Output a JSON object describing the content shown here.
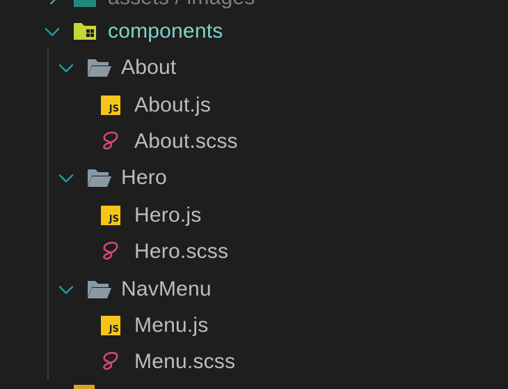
{
  "explorer": {
    "partial_top_label": "assets / images",
    "components_label": "components",
    "items": [
      {
        "label": "About",
        "type": "folder"
      },
      {
        "label": "About.js",
        "type": "js"
      },
      {
        "label": "About.scss",
        "type": "scss"
      },
      {
        "label": "Hero",
        "type": "folder"
      },
      {
        "label": "Hero.js",
        "type": "js"
      },
      {
        "label": "Hero.scss",
        "type": "scss"
      },
      {
        "label": "NavMenu",
        "type": "folder"
      },
      {
        "label": "Menu.js",
        "type": "js"
      },
      {
        "label": "Menu.scss",
        "type": "scss"
      }
    ],
    "js_badge": "JS"
  },
  "colors": {
    "background": "#1e1e1e",
    "text": "#bdbdbd",
    "components_text": "#7fd3c8",
    "chevron": "#1aa3a3",
    "folder_gray": "#8a9aa5",
    "components_folder": "#c4d63a",
    "sass_pink": "#d9457c",
    "js_yellow": "#f5c518"
  },
  "icons": {
    "chevron": "chevron-down-icon",
    "folder": "folder-open-icon",
    "js": "javascript-file-icon",
    "scss": "sass-file-icon"
  }
}
